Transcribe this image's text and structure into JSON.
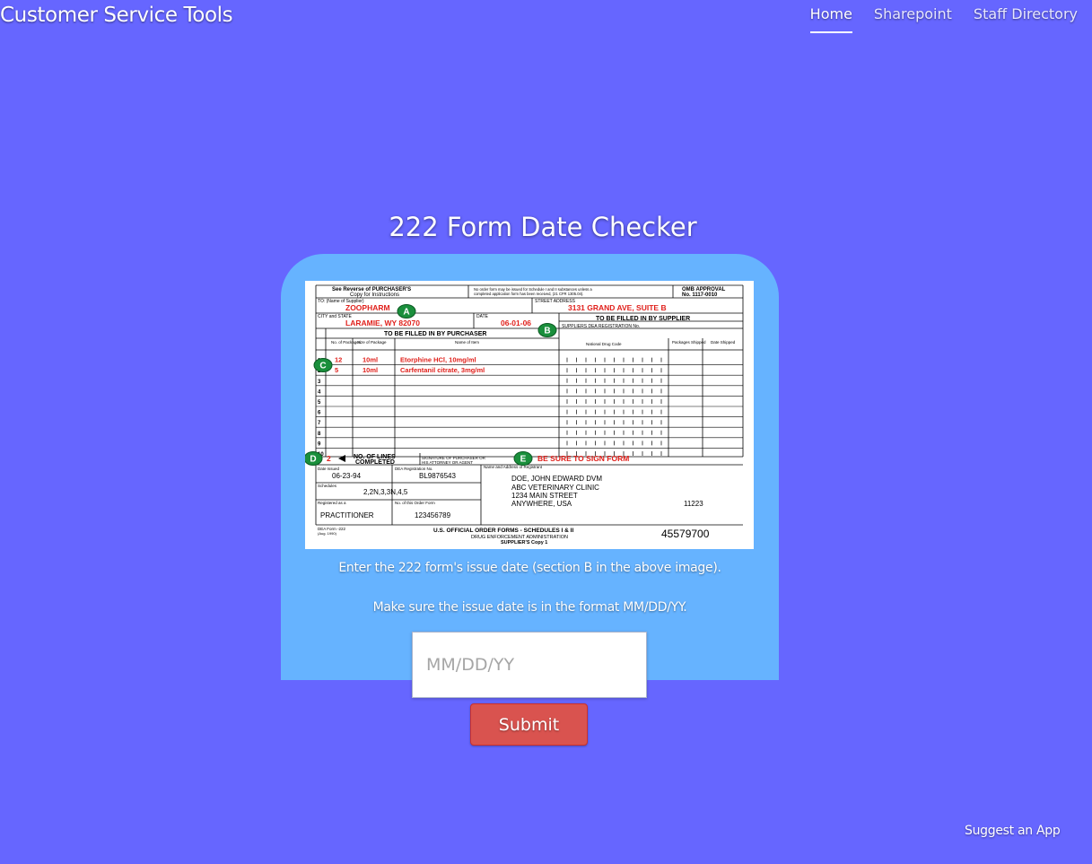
{
  "header": {
    "brand": "Customer Service Tools",
    "nav": [
      {
        "label": "Home",
        "active": true
      },
      {
        "label": "Sharepoint",
        "active": false
      },
      {
        "label": "Staff Directory",
        "active": false
      }
    ]
  },
  "main": {
    "title": "222 Form Date Checker",
    "instructions": [
      "Enter the 222 form's issue date (section B in the above image).",
      "Make sure the issue date is in the format MM/DD/YY."
    ],
    "date_input": {
      "value": "",
      "placeholder": "MM/DD/YY"
    },
    "submit_label": "Submit"
  },
  "form_image": {
    "header_left_1": "See Reverse of PURCHASER'S",
    "header_left_2": "Copy for Instructions",
    "header_mid_1": "No order form may be issued for Schedule I and II substances unless a",
    "header_mid_2": "completed application form has been received, (21 CFR 1305.04).",
    "omb_1": "OMB APPROVAL",
    "omb_2": "No. 1117-0010",
    "to_label": "TO: (Name of Supplier)",
    "supplier": "ZOOPHARM",
    "street_label": "STREET ADDRESS",
    "street": "3131 GRAND AVE, SUITE B",
    "city_label": "CITY and STATE",
    "city": "LARAMIE, WY 82070",
    "date_label": "DATE",
    "date": "06-01-06",
    "supplier_fill": "TO BE FILLED IN BY SUPPLIER",
    "dea_reg_label": "SUPPLIERS DEA REGISTRATION No.",
    "purchaser_fill": "TO BE FILLED IN BY PURCHASER",
    "col_packages": "No. of Packages",
    "col_size": "Size of Package",
    "col_item": "Name of Item",
    "col_ndc": "National Drug Code",
    "col_shipped": "Packages Shipped",
    "col_date_shipped": "Date Shipped",
    "rows": [
      {
        "num": "1",
        "packages": "12",
        "size": "10ml",
        "item": "Etorphine HCl, 10mg/ml"
      },
      {
        "num": "2",
        "packages": "5",
        "size": "10ml",
        "item": "Carfentanil citrate, 3mg/ml"
      },
      {
        "num": "3",
        "packages": "",
        "size": "",
        "item": ""
      },
      {
        "num": "4",
        "packages": "",
        "size": "",
        "item": ""
      },
      {
        "num": "5",
        "packages": "",
        "size": "",
        "item": ""
      },
      {
        "num": "6",
        "packages": "",
        "size": "",
        "item": ""
      },
      {
        "num": "7",
        "packages": "",
        "size": "",
        "item": ""
      },
      {
        "num": "8",
        "packages": "",
        "size": "",
        "item": ""
      },
      {
        "num": "9",
        "packages": "",
        "size": "",
        "item": ""
      },
      {
        "num": "10",
        "packages": "",
        "size": "",
        "item": ""
      }
    ],
    "lines_completed": "2",
    "lines_label_1": "NO. OF LINES",
    "lines_label_2": "COMPLETED",
    "signature_label_1": "SIGNATURE OF PURCHASER OR",
    "signature_label_2": "HIS ATTORNEY OR AGENT",
    "sign_note": "BE SURE TO SIGN FORM",
    "date_issued_label": "Date Issued",
    "date_issued": "06-23-94",
    "dea_no_label": "DEA Registration No.",
    "dea_no": "BL9876543",
    "name_addr_label": "Name and Address of Registrant",
    "registrant": [
      "DOE, JOHN EDWARD DVM",
      "ABC VETERINARY CLINIC",
      "1234 MAIN STREET",
      "ANYWHERE, USA"
    ],
    "zip": "11223",
    "schedules_label": "Schedules",
    "schedules": "2,2N,3,3N,4,5",
    "registered_label": "Registered as a",
    "registered": "PRACTITIONER",
    "order_no_label": "No. of this Order Form",
    "order_no": "123456789",
    "form_id_1": "DEA Form -222",
    "form_id_2": "(Aug. 1990)",
    "footer_1": "U.S. OFFICIAL ORDER FORMS - SCHEDULES I & II",
    "footer_2": "DRUG ENFORCEMENT ADMINISTRATION",
    "footer_3": "SUPPLIER'S Copy 1",
    "serial": "45579700",
    "markers": [
      "A",
      "B",
      "C",
      "D",
      "E"
    ],
    "red_ink": "#e0201b",
    "marker_green": "#1a8f3c"
  },
  "footer": {
    "suggest": "Suggest an App"
  },
  "colors": {
    "background": "#6666ff",
    "card": "#66b3ff",
    "submit": "#d9534f"
  }
}
